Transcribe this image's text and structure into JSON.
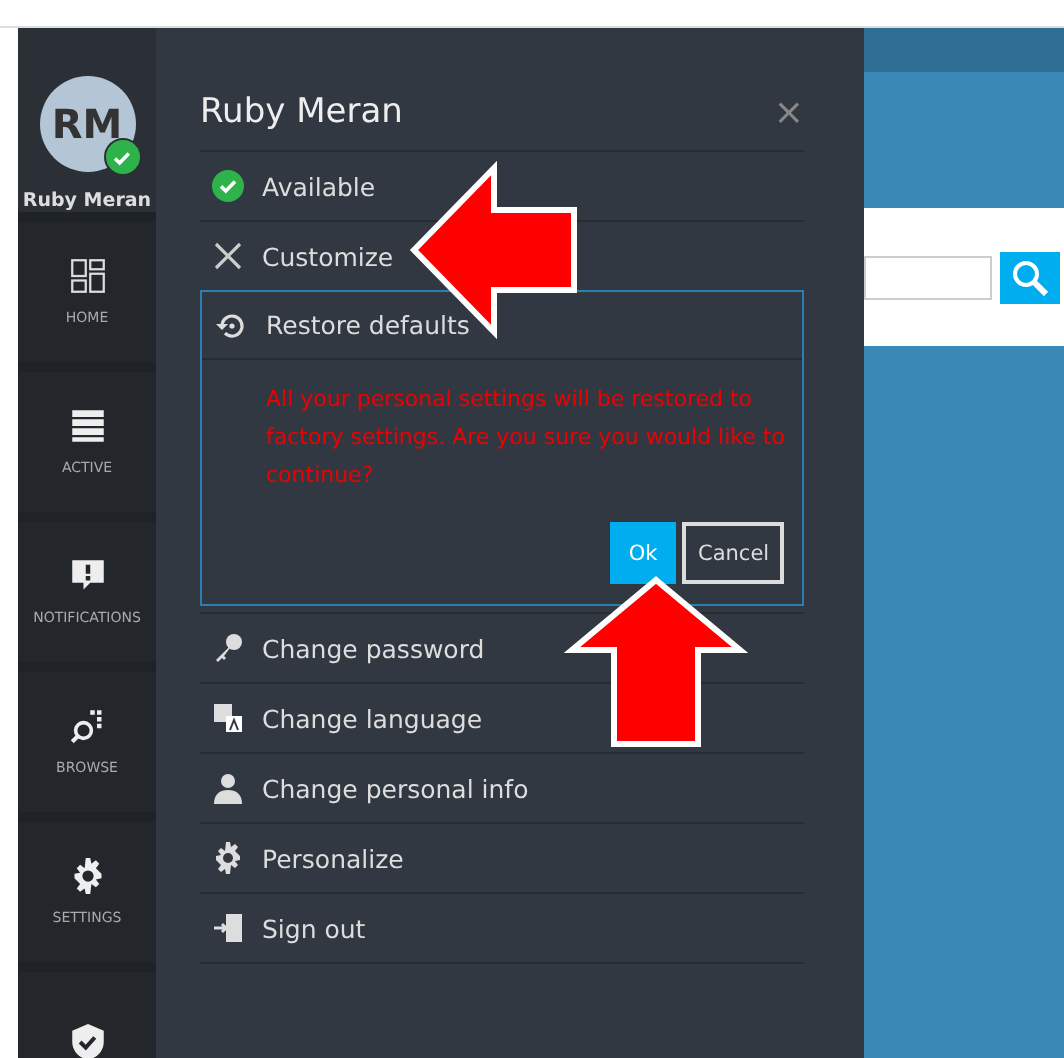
{
  "sidebar": {
    "avatar": {
      "initials": "RM",
      "online": true
    },
    "user_name": "Ruby Meran",
    "items": [
      {
        "kind": "home",
        "label": "HOME",
        "selected": false
      },
      {
        "kind": "active",
        "label": "ACTIVE",
        "selected": false
      },
      {
        "kind": "notifications",
        "label": "NOTIFICATIONS",
        "selected": false
      },
      {
        "kind": "browse",
        "label": "BROWSE",
        "selected": false
      },
      {
        "kind": "settings",
        "label": "SETTINGS",
        "selected": false
      },
      {
        "kind": "shield",
        "selected": false
      }
    ]
  },
  "panel": {
    "title": "Ruby Meran",
    "close": "×",
    "menu_top": [
      {
        "kind": "available",
        "label": "Available"
      },
      {
        "kind": "customize",
        "label": "Customize"
      }
    ],
    "confirm": {
      "title": "Restore defaults",
      "message": "All your personal settings will be restored to factory settings. Are you sure you would like to continue?",
      "ok": "Ok",
      "cancel": "Cancel"
    },
    "menu_bottom": [
      {
        "kind": "key",
        "label": "Change password"
      },
      {
        "kind": "language",
        "label": "Change language"
      },
      {
        "kind": "person",
        "label": "Change personal info"
      },
      {
        "kind": "gear",
        "label": "Personalize"
      },
      {
        "kind": "signout",
        "label": "Sign out"
      }
    ]
  }
}
